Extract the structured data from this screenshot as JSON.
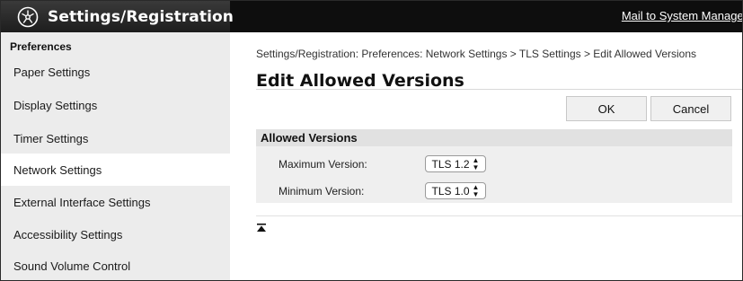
{
  "header": {
    "title": "Settings/Registration",
    "mail_link": "Mail to System Manager",
    "logo_icon": "settings-registration-icon"
  },
  "sidebar": {
    "heading": "Preferences",
    "items": [
      {
        "label": "Paper Settings",
        "active": false
      },
      {
        "label": "Display Settings",
        "active": false
      },
      {
        "label": "Timer Settings",
        "active": false
      },
      {
        "label": "Network Settings",
        "active": true
      },
      {
        "label": "External Interface Settings",
        "active": false
      },
      {
        "label": "Accessibility Settings",
        "active": false
      },
      {
        "label": "Sound Volume Control",
        "active": false
      }
    ]
  },
  "main": {
    "breadcrumb": "Settings/Registration: Preferences: Network Settings > TLS Settings > Edit Allowed Versions",
    "title": "Edit Allowed Versions",
    "ok_label": "OK",
    "cancel_label": "Cancel",
    "section": {
      "title": "Allowed Versions",
      "fields": [
        {
          "label": "Maximum Version:",
          "value": "TLS 1.2"
        },
        {
          "label": "Minimum Version:",
          "value": "TLS 1.0"
        }
      ]
    },
    "to_top_icon": "to-top-icon"
  },
  "colors": {
    "header_bg": "#0e0e0e",
    "sidebar_bg": "#ececec",
    "section_bg": "#efefef",
    "section_header_bg": "#e1e1e1"
  }
}
